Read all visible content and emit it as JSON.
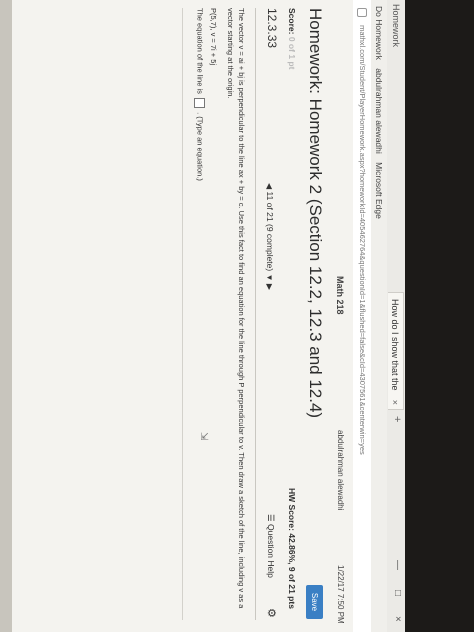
{
  "browser": {
    "app_label": "Homework",
    "tab_title": "How do I show that the",
    "tab_close": "×",
    "new_tab": "+",
    "win_min": "—",
    "win_max": "□",
    "win_close": "×",
    "bookmarks": [
      "Do Homework",
      "abdulrahman alewadhi",
      "Microsoft Edge"
    ],
    "url": "mathxl.com/Student/PlayerHomework.aspx?homeworkId=405462764&questionId=1&flushed=false&cId=4307561&centerwin=yes"
  },
  "header": {
    "course": "Math 218",
    "user": "abdulrahman alewadhi",
    "date": "1/22/17 7:50 PM"
  },
  "page": {
    "title": "Homework: Homework 2 (Section 12.2, 12.3 and 12.4)",
    "save_label": "Save",
    "score_label": "Score:",
    "score_value": "0 of 1 pt",
    "hw_score": "HW Score: 42.86%, 9 of 21 pts",
    "question_number": "12.3.33",
    "nav_text": "11 of 21 (9 complete)",
    "question_help": "Question Help"
  },
  "problem": {
    "text": "The vector v = ai + bj is perpendicular to the line ax + by = c. Use this fact to find an equation  for the line through P perpendicular to v. Then draw a sketch of the line, including v as a vector starting at the origin.",
    "given": "P(5,7), v = 7i + 5j",
    "answer_prefix": "The equation of the line is",
    "answer_suffix": ". (Type an equation.)"
  },
  "icons": {
    "gear": "⚙",
    "prev": "◀",
    "next": "▶",
    "dropdown": "▼",
    "question_help_icon": "☰",
    "user_icon": "👤"
  }
}
